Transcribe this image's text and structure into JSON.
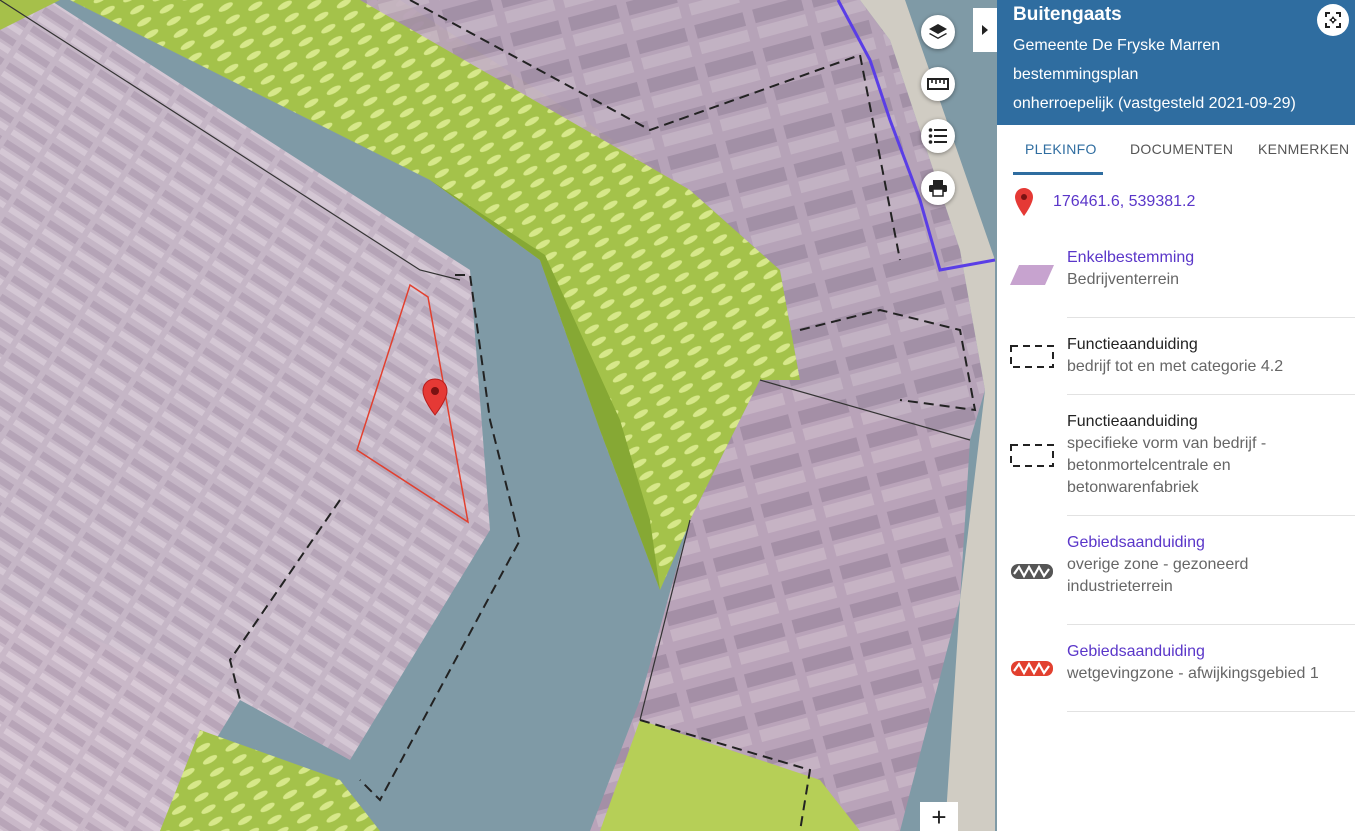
{
  "panel": {
    "title": "Buitengaats",
    "municipality": "Gemeente De Fryske Marren",
    "plan_type": "bestemmingsplan",
    "status": "onherroepelijk (vastgesteld 2021-09-29)",
    "tabs": [
      "PLEKINFO",
      "DOCUMENTEN",
      "KENMERKEN"
    ],
    "active_tab": "PLEKINFO",
    "coordinates": "176461.6, 539381.2",
    "items": [
      {
        "title": "Enkelbestemming",
        "subtitle": "Bedrijventerrein",
        "symbol": "purple-parallelogram",
        "linked": true
      },
      {
        "title": "Functieaanduiding",
        "subtitle": "bedrijf tot en met categorie 4.2",
        "symbol": "dashed-rectangle",
        "linked": false
      },
      {
        "title": "Functieaanduiding",
        "subtitle": "specifieke vorm van bedrijf - betonmortelcentrale en betonwarenfabriek",
        "symbol": "dashed-rectangle",
        "linked": false
      },
      {
        "title": "Gebiedsaanduiding",
        "subtitle": "overige zone - gezoneerd industrieterrein",
        "symbol": "grey-zigzag-band",
        "linked": true
      },
      {
        "title": "Gebiedsaanduiding",
        "subtitle": "wetgevingzone - afwijkingsgebied 1",
        "symbol": "red-zigzag-band",
        "linked": true
      }
    ]
  },
  "map_controls": {
    "layers": "layers-icon",
    "measure": "ruler-icon",
    "legend": "list-icon",
    "print": "print-icon",
    "collapse": "caret-right-icon",
    "zoom_in": "+",
    "fullscreen": "expand-icon"
  },
  "colors": {
    "header_blue": "#2f6da0",
    "link_purple": "#5a36c9",
    "business_area": "#c7a3c9",
    "green_zone": "#9abf3a",
    "water": "#7f9aa6",
    "marker_red": "#e53935"
  }
}
